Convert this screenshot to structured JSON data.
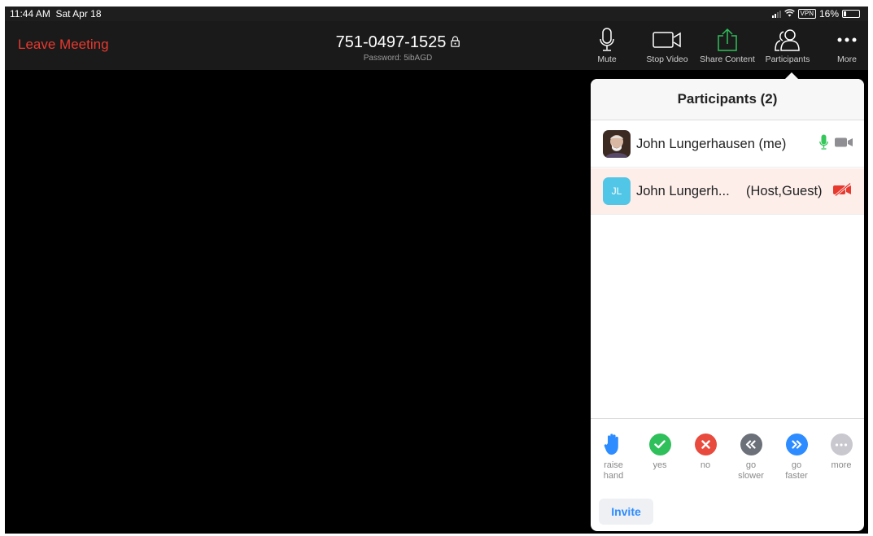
{
  "status_bar": {
    "time": "11:44 AM",
    "date": "Sat Apr 18",
    "vpn": "VPN",
    "battery": "16%"
  },
  "toolbar": {
    "leave_label": "Leave Meeting",
    "meeting_id": "751-0497-1525",
    "password": "Password: 5ibAGD",
    "buttons": [
      {
        "label": "Mute",
        "icon": "microphone-icon"
      },
      {
        "label": "Stop Video",
        "icon": "video-camera-icon"
      },
      {
        "label": "Share Content",
        "icon": "share-upload-icon"
      },
      {
        "label": "Participants",
        "icon": "participants-icon"
      },
      {
        "label": "More",
        "icon": "more-dots-icon"
      }
    ]
  },
  "participants": {
    "title": "Participants (2)",
    "rows": [
      {
        "name": "John Lungerhausen",
        "role": "(me)",
        "avatar": "photo",
        "mic": "on",
        "video": "on"
      },
      {
        "name": "John Lungerh...",
        "role": "(Host,Guest)",
        "initials": "JL",
        "video": "off"
      }
    ]
  },
  "feedback": [
    {
      "label": "raise hand",
      "icon": "raise-hand-icon",
      "color": "#2d8cff"
    },
    {
      "label": "yes",
      "icon": "check-icon",
      "color": "#2fbf5b"
    },
    {
      "label": "no",
      "icon": "x-icon",
      "color": "#e84a3d"
    },
    {
      "label": "go slower",
      "icon": "rewind-icon",
      "color": "#6b7079"
    },
    {
      "label": "go faster",
      "icon": "fast-forward-icon",
      "color": "#2d8cff"
    },
    {
      "label": "more",
      "icon": "more-dots-icon",
      "color": "#c8c8ce"
    }
  ],
  "invite_label": "Invite",
  "colors": {
    "leave": "#e8392f",
    "accent": "#2d8cff",
    "share": "#2fbf5b",
    "muted_video": "#e8392f"
  }
}
